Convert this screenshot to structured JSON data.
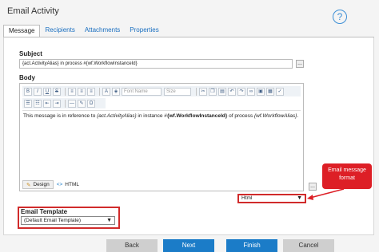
{
  "window": {
    "title": "Email Activity",
    "help_glyph": "?"
  },
  "tabs": [
    {
      "label": "Message",
      "active": true
    },
    {
      "label": "Recipients",
      "active": false
    },
    {
      "label": "Attachments",
      "active": false
    },
    {
      "label": "Properties",
      "active": false
    }
  ],
  "subject": {
    "label": "Subject",
    "value": "{act.ActivityAlias} in process #{wf.WorkflowInstanceId}",
    "ellipsis": "..."
  },
  "body": {
    "label": "Body",
    "toolbar": {
      "font_name_placeholder": "Font Name",
      "size_placeholder": "Size"
    },
    "content": {
      "prefix": "This message is in reference to ",
      "activity_alias": "{act.ActivityAlias}",
      "middle": " in instance #",
      "instance_id": "{wf.WorkflowInstanceId}",
      "middle2": " of process ",
      "workflow_alias": "{wf.WorkflowAlias}",
      "suffix": "."
    },
    "modes": {
      "design": "Design",
      "html": "HTML"
    },
    "ellipsis": "..."
  },
  "format": {
    "selected": "Html"
  },
  "callout": {
    "text": "Email message format"
  },
  "email_template": {
    "label": "Email Template",
    "selected": "(Default Email Template)"
  },
  "buttons": {
    "back": "Back",
    "next": "Next",
    "finish": "Finish",
    "cancel": "Cancel"
  },
  "colors": {
    "accent": "#1b7cc8",
    "callout": "#dd1f26",
    "highlight_border": "#d12b2b"
  }
}
